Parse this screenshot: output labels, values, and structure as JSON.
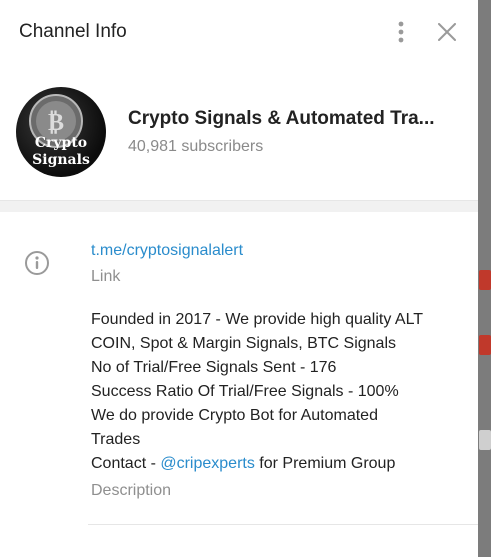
{
  "header": {
    "title": "Channel Info",
    "more_icon": "more-vertical-icon",
    "close_icon": "close-icon"
  },
  "profile": {
    "avatar_text_line1": "Crypto",
    "avatar_text_line2": "Signals",
    "name": "Crypto Signals & Automated Tra...",
    "subscribers": "40,981 subscribers"
  },
  "info": {
    "icon": "info-icon",
    "link": "t.me/cryptosignalalert",
    "link_label": "Link",
    "description_lines": [
      "Founded in 2017 - We provide high quality ALT",
      "COIN, Spot & Margin Signals, BTC Signals",
      "No of Trial/Free Signals Sent - 176",
      "Success Ratio Of Trial/Free Signals - 100%",
      "We do provide Crypto Bot for Automated",
      "Trades"
    ],
    "contact_prefix": "Contact - ",
    "contact_mention": "@cripexperts",
    "contact_suffix": " for Premium Group",
    "description_label": "Description"
  },
  "colors": {
    "link": "#2a8ccc",
    "muted": "#8f8f8f",
    "text": "#222222"
  }
}
